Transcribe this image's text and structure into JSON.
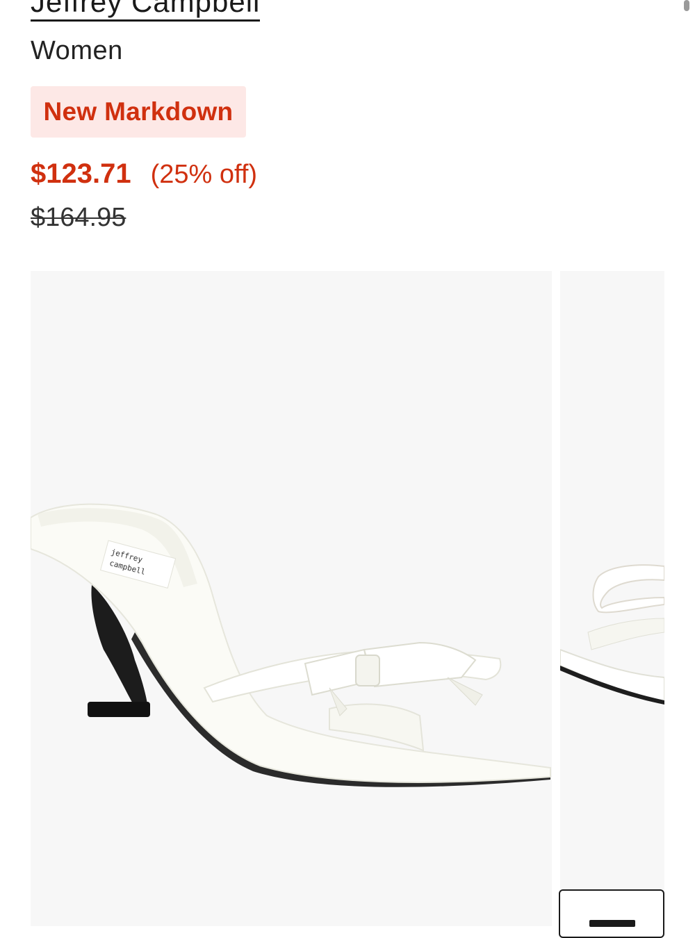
{
  "product": {
    "brand": "Jeffrey Campbell",
    "category": "Women",
    "badge": "New Markdown",
    "sale_price": "$123.71",
    "discount": "(25% off)",
    "original_price": "$164.95"
  },
  "gallery": {
    "insole_logo_line1": "jeffrey",
    "insole_logo_line2": "campbell"
  },
  "colors": {
    "sale": "#d0300f",
    "badge_bg": "#fde8e6",
    "image_bg": "#f7f7f7"
  }
}
